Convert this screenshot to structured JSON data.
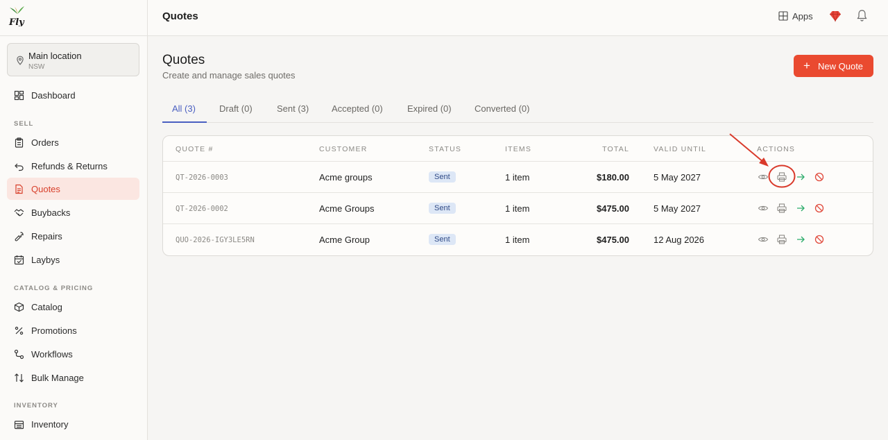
{
  "sidebar": {
    "logo_text": "Fly",
    "location": {
      "name": "Main location",
      "region": "NSW"
    },
    "items": [
      {
        "label": "Dashboard"
      },
      {
        "label": "Orders"
      },
      {
        "label": "Refunds & Returns"
      },
      {
        "label": "Quotes"
      },
      {
        "label": "Buybacks"
      },
      {
        "label": "Repairs"
      },
      {
        "label": "Laybys"
      },
      {
        "label": "Catalog"
      },
      {
        "label": "Promotions"
      },
      {
        "label": "Workflows"
      },
      {
        "label": "Bulk Manage"
      },
      {
        "label": "Inventory"
      }
    ],
    "sections": {
      "sell": "SELL",
      "catalog": "CATALOG & PRICING",
      "inventory": "INVENTORY"
    },
    "active_item": "Quotes"
  },
  "topbar": {
    "title": "Quotes",
    "apps_label": "Apps",
    "gem_icon": "ruby-gem-icon",
    "bell_icon": "bell-icon"
  },
  "page": {
    "title": "Quotes",
    "subtitle": "Create and manage sales quotes",
    "new_button": "New Quote",
    "tabs": [
      {
        "label": "All (3)"
      },
      {
        "label": "Draft (0)"
      },
      {
        "label": "Sent (3)"
      },
      {
        "label": "Accepted (0)"
      },
      {
        "label": "Expired (0)"
      },
      {
        "label": "Converted (0)"
      }
    ],
    "active_tab": "All (3)"
  },
  "table": {
    "headers": {
      "quote": "QUOTE #",
      "customer": "CUSTOMER",
      "status": "STATUS",
      "items": "ITEMS",
      "total": "TOTAL",
      "valid": "VALID UNTIL",
      "actions": "ACTIONS"
    },
    "rows": [
      {
        "quote": "QT-2026-0003",
        "customer": "Acme groups",
        "status": "Sent",
        "items": "1 item",
        "total": "$180.00",
        "valid": "5 May 2027"
      },
      {
        "quote": "QT-2026-0002",
        "customer": "Acme Groups",
        "status": "Sent",
        "items": "1 item",
        "total": "$475.00",
        "valid": "5 May 2027"
      },
      {
        "quote": "QUO-2026-IGY3LE5RN",
        "customer": "Acme Group",
        "status": "Sent",
        "items": "1 item",
        "total": "$475.00",
        "valid": "12 Aug 2026"
      }
    ],
    "action_icons": [
      "eye-icon",
      "printer-icon",
      "arrow-right-icon",
      "cancel-icon"
    ]
  },
  "colors": {
    "accent": "#ea4a30",
    "active_tab": "#4a5fc1",
    "badge_bg": "#dde7f6",
    "convert_green": "#2bab6a",
    "cancel_red": "#e0483a",
    "annotation_red": "#d93a2b"
  }
}
